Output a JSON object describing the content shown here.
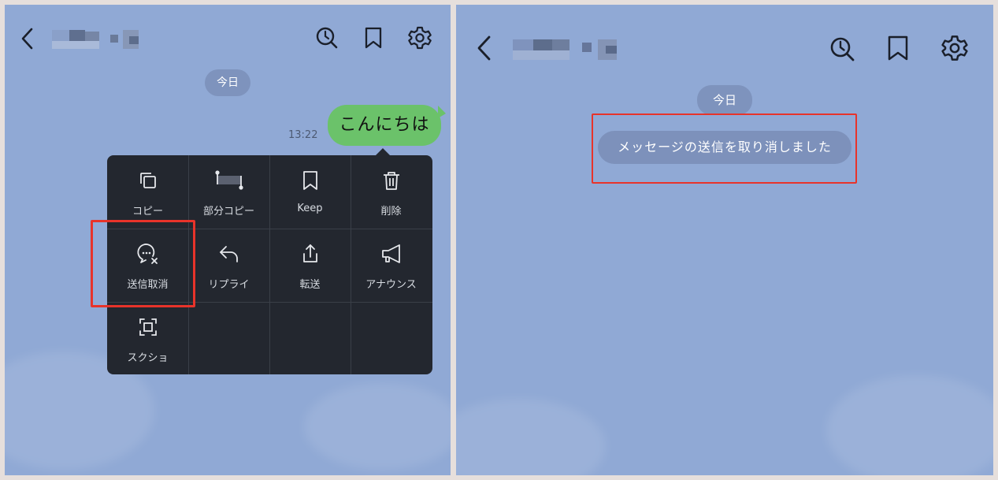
{
  "left_panel": {
    "date_label": "今日",
    "message_text": "こんにちは",
    "message_time": "13:22",
    "context_menu": {
      "items": [
        {
          "label": "コピー",
          "icon": "copy-icon"
        },
        {
          "label": "部分コピー",
          "icon": "partial-copy-icon"
        },
        {
          "label": "Keep",
          "icon": "bookmark-icon"
        },
        {
          "label": "削除",
          "icon": "trash-icon"
        },
        {
          "label": "送信取消",
          "icon": "unsend-icon"
        },
        {
          "label": "リプライ",
          "icon": "reply-icon"
        },
        {
          "label": "転送",
          "icon": "share-icon"
        },
        {
          "label": "アナウンス",
          "icon": "megaphone-icon"
        },
        {
          "label": "スクショ",
          "icon": "screenshot-icon"
        }
      ]
    }
  },
  "right_panel": {
    "date_label": "今日",
    "unsent_notice": "メッセージの送信を取り消しました"
  },
  "header_icons": [
    "back-arrow-icon",
    "search-history-icon",
    "bookmark-icon",
    "gear-icon"
  ],
  "colors": {
    "chat_background": "#90a9d5",
    "bubble_green": "#6bc26a",
    "menu_dark": "#23272f",
    "highlight_red": "#e8332a"
  }
}
